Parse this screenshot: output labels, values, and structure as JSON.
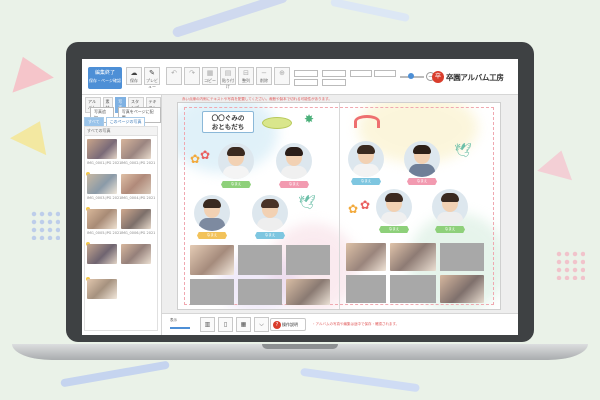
{
  "header": {
    "finish_label": "編集終了",
    "finish_sub": "保存・ページ確認",
    "tools": [
      {
        "icon": "☁",
        "label": "保存"
      },
      {
        "icon": "✎",
        "label": "プレビュー"
      },
      {
        "icon": "↶",
        "label": ""
      },
      {
        "icon": "↷",
        "label": ""
      },
      {
        "icon": "▦",
        "label": "コピー"
      },
      {
        "icon": "▤",
        "label": "貼り付け"
      },
      {
        "icon": "⊟",
        "label": "整列"
      },
      {
        "icon": "−",
        "label": "削除"
      },
      {
        "icon": "⊕",
        "label": ""
      }
    ],
    "logo_mark": "卒",
    "logo_text": "卒園アルバム工房"
  },
  "left_panel": {
    "tabs": [
      "アルバム",
      "素材",
      "写真",
      "スタンプ",
      "テキスト"
    ],
    "active_tab": 2,
    "sub_buttons": [
      "写真追加",
      "写真をページに配置"
    ],
    "subtabs": [
      "すべて",
      "このページの写真"
    ],
    "list_header": "すべての写真",
    "photos": [
      {
        "caption": "IMG_0001.JPG 2021/03"
      },
      {
        "caption": "IMG_0002.JPG 2021/03"
      },
      {
        "caption": "IMG_0003.JPG 2021/03"
      },
      {
        "caption": "IMG_0004.JPG 2021/03"
      },
      {
        "caption": "IMG_0005.JPG 2021/03"
      },
      {
        "caption": "IMG_0006.JPG 2021/03"
      }
    ]
  },
  "canvas": {
    "info_text": "赤い点線の内側にテキストや写真を配置してください。裁断や製本で切れる可能性があります。",
    "title_line1": "〇〇ぐみの",
    "title_line2": "おともだち",
    "names": [
      "なまえ",
      "なまえ",
      "なまえ",
      "なまえ",
      "なまえ",
      "なまえ",
      "なまえ",
      "なまえ",
      "なまえ"
    ]
  },
  "bottom_bar": {
    "zoom_label": "表示",
    "help_mark": "?",
    "help_label": "操作説明",
    "note": "・アルバムの写真や編集は途中で保存・確認されます。"
  },
  "colors": {
    "accent": "#4d8fd6",
    "ribbon_green": "#8ed07a",
    "warning_red": "#e05a5a",
    "logo_red": "#d93d2c"
  }
}
